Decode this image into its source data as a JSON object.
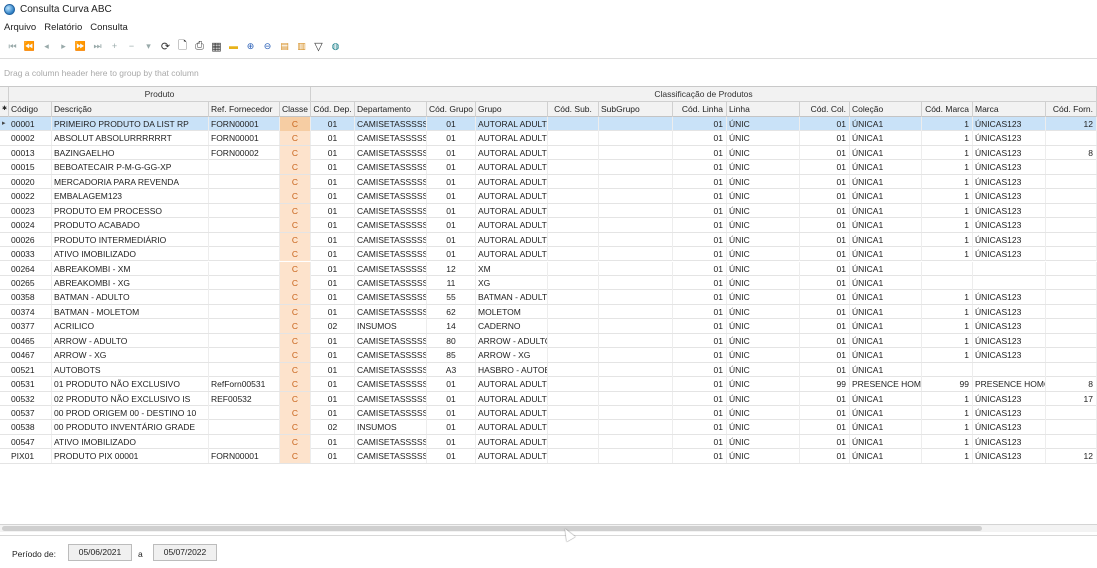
{
  "window": {
    "title": "Consulta Curva ABC"
  },
  "menu": [
    "Arquivo",
    "Relatório",
    "Consulta"
  ],
  "toolbar": {
    "nav": [
      "⏮",
      "⏪",
      "◂",
      "▸",
      "⏩",
      "⏭",
      "+",
      "−",
      "▾"
    ],
    "actions": [
      {
        "icon": "refresh-icon",
        "glyph": "⟳",
        "cls": "active"
      },
      {
        "icon": "preview-icon",
        "glyph": "🗋",
        "cls": "active"
      },
      {
        "icon": "print-icon",
        "glyph": "⎙",
        "cls": "active"
      },
      {
        "icon": "export-icon",
        "glyph": "▦",
        "cls": "active"
      },
      {
        "icon": "highlight-icon",
        "glyph": "▬",
        "cls": "yellow"
      },
      {
        "icon": "zoom-in-icon",
        "glyph": "⊕",
        "cls": "blue"
      },
      {
        "icon": "zoom-out-icon",
        "glyph": "⊖",
        "cls": "blue"
      },
      {
        "icon": "layout-icon",
        "glyph": "▤",
        "cls": "orange"
      },
      {
        "icon": "report-icon",
        "glyph": "▥",
        "cls": "orange"
      },
      {
        "icon": "filter-icon",
        "glyph": "▽",
        "cls": "active"
      },
      {
        "icon": "globe-icon",
        "glyph": "◍",
        "cls": "teal"
      }
    ]
  },
  "group_panel": {
    "text": "Drag a column header here to group by that column"
  },
  "bands": [
    {
      "label": "Produto",
      "key": "produto"
    },
    {
      "label": "Classificação de Produtos",
      "key": "classificacao"
    }
  ],
  "columns": [
    {
      "key": "codigo",
      "label": "Código",
      "align": "left"
    },
    {
      "key": "descricao",
      "label": "Descrição",
      "align": "left"
    },
    {
      "key": "ref",
      "label": "Ref. Fornecedor",
      "align": "left"
    },
    {
      "key": "classe",
      "label": "Classe",
      "align": "center"
    },
    {
      "key": "cod_dep",
      "label": "Cód. Dep.",
      "align": "center"
    },
    {
      "key": "departamento",
      "label": "Departamento",
      "align": "left"
    },
    {
      "key": "cod_grupo",
      "label": "Cód. Grupo",
      "align": "center"
    },
    {
      "key": "grupo",
      "label": "Grupo",
      "align": "left"
    },
    {
      "key": "cod_sub",
      "label": "Cód. Sub.",
      "align": "center"
    },
    {
      "key": "subgrupo",
      "label": "SubGrupo",
      "align": "left"
    },
    {
      "key": "cod_linha",
      "label": "Cód. Linha",
      "align": "num"
    },
    {
      "key": "linha",
      "label": "Linha",
      "align": "left"
    },
    {
      "key": "cod_col",
      "label": "Cód. Col.",
      "align": "num"
    },
    {
      "key": "colecao",
      "label": "Coleção",
      "align": "left"
    },
    {
      "key": "cod_marca",
      "label": "Cód. Marca",
      "align": "num"
    },
    {
      "key": "marca",
      "label": "Marca",
      "align": "left"
    },
    {
      "key": "cod_forn",
      "label": "Cód. Forn.",
      "align": "num"
    }
  ],
  "rows": [
    [
      "00001",
      "PRIMEIRO PRODUTO DA LIST RP",
      "FORN00001",
      "C",
      "01",
      "CAMISETASSSSSS",
      "01",
      "AUTORAL ADULTO",
      "",
      "",
      "01",
      "ÚNIC",
      "01",
      "ÚNICA1",
      "1",
      "ÚNICAS123",
      "12"
    ],
    [
      "00002",
      "ABSOLUT ABSOLURRRRRRT",
      "FORN00001",
      "C",
      "01",
      "CAMISETASSSSSS",
      "01",
      "AUTORAL ADULTO",
      "",
      "",
      "01",
      "ÚNIC",
      "01",
      "ÚNICA1",
      "1",
      "ÚNICAS123",
      ""
    ],
    [
      "00013",
      "BAZINGAELHO",
      "FORN00002",
      "C",
      "01",
      "CAMISETASSSSSS",
      "01",
      "AUTORAL ADULTO",
      "",
      "",
      "01",
      "ÚNIC",
      "01",
      "ÚNICA1",
      "1",
      "ÚNICAS123",
      "8"
    ],
    [
      "00015",
      "BEBOATECAIR P-M-G-GG-XP",
      "",
      "C",
      "01",
      "CAMISETASSSSSS",
      "01",
      "AUTORAL ADULTO",
      "",
      "",
      "01",
      "ÚNIC",
      "01",
      "ÚNICA1",
      "1",
      "ÚNICAS123",
      ""
    ],
    [
      "00020",
      "MERCADORIA PARA REVENDA",
      "",
      "C",
      "01",
      "CAMISETASSSSSS",
      "01",
      "AUTORAL ADULTO",
      "",
      "",
      "01",
      "ÚNIC",
      "01",
      "ÚNICA1",
      "1",
      "ÚNICAS123",
      ""
    ],
    [
      "00022",
      "EMBALAGEM123",
      "",
      "C",
      "01",
      "CAMISETASSSSSS",
      "01",
      "AUTORAL ADULTO",
      "",
      "",
      "01",
      "ÚNIC",
      "01",
      "ÚNICA1",
      "1",
      "ÚNICAS123",
      ""
    ],
    [
      "00023",
      "PRODUTO EM PROCESSO",
      "",
      "C",
      "01",
      "CAMISETASSSSSS",
      "01",
      "AUTORAL ADULTO",
      "",
      "",
      "01",
      "ÚNIC",
      "01",
      "ÚNICA1",
      "1",
      "ÚNICAS123",
      ""
    ],
    [
      "00024",
      "PRODUTO ACABADO",
      "",
      "C",
      "01",
      "CAMISETASSSSSS",
      "01",
      "AUTORAL ADULTO",
      "",
      "",
      "01",
      "ÚNIC",
      "01",
      "ÚNICA1",
      "1",
      "ÚNICAS123",
      ""
    ],
    [
      "00026",
      "PRODUTO INTERMEDIÁRIO",
      "",
      "C",
      "01",
      "CAMISETASSSSSS",
      "01",
      "AUTORAL ADULTO",
      "",
      "",
      "01",
      "ÚNIC",
      "01",
      "ÚNICA1",
      "1",
      "ÚNICAS123",
      ""
    ],
    [
      "00033",
      "ATIVO IMOBILIZADO",
      "",
      "C",
      "01",
      "CAMISETASSSSSS",
      "01",
      "AUTORAL ADULTO",
      "",
      "",
      "01",
      "ÚNIC",
      "01",
      "ÚNICA1",
      "1",
      "ÚNICAS123",
      ""
    ],
    [
      "00264",
      "ABREAKOMBI - XM",
      "",
      "C",
      "01",
      "CAMISETASSSSSS",
      "12",
      "XM",
      "",
      "",
      "01",
      "ÚNIC",
      "01",
      "ÚNICA1",
      "",
      "",
      ""
    ],
    [
      "00265",
      "ABREAKOMBI - XG",
      "",
      "C",
      "01",
      "CAMISETASSSSSS",
      "11",
      "XG",
      "",
      "",
      "01",
      "ÚNIC",
      "01",
      "ÚNICA1",
      "",
      "",
      ""
    ],
    [
      "00358",
      "BATMAN - ADULTO",
      "",
      "C",
      "01",
      "CAMISETASSSSSS",
      "55",
      "BATMAN - ADULTO",
      "",
      "",
      "01",
      "ÚNIC",
      "01",
      "ÚNICA1",
      "1",
      "ÚNICAS123",
      ""
    ],
    [
      "00374",
      "BATMAN - MOLETOM",
      "",
      "C",
      "01",
      "CAMISETASSSSSS",
      "62",
      "MOLETOM",
      "",
      "",
      "01",
      "ÚNIC",
      "01",
      "ÚNICA1",
      "1",
      "ÚNICAS123",
      ""
    ],
    [
      "00377",
      "ACRILICO",
      "",
      "C",
      "02",
      "INSUMOS",
      "14",
      "CADERNO",
      "",
      "",
      "01",
      "ÚNIC",
      "01",
      "ÚNICA1",
      "1",
      "ÚNICAS123",
      ""
    ],
    [
      "00465",
      "ARROW - ADULTO",
      "",
      "C",
      "01",
      "CAMISETASSSSSS",
      "80",
      "ARROW - ADULTO",
      "",
      "",
      "01",
      "ÚNIC",
      "01",
      "ÚNICA1",
      "1",
      "ÚNICAS123",
      ""
    ],
    [
      "00467",
      "ARROW - XG",
      "",
      "C",
      "01",
      "CAMISETASSSSSS",
      "85",
      "ARROW - XG",
      "",
      "",
      "01",
      "ÚNIC",
      "01",
      "ÚNICA1",
      "1",
      "ÚNICAS123",
      ""
    ],
    [
      "00521",
      "AUTOBOTS",
      "",
      "C",
      "01",
      "CAMISETASSSSSS",
      "A3",
      "HASBRO - AUTOBOTS",
      "",
      "",
      "01",
      "ÚNIC",
      "01",
      "ÚNICA1",
      "",
      "",
      ""
    ],
    [
      "00531",
      "01 PRODUTO NÃO EXCLUSIVO",
      "RefForn00531",
      "C",
      "01",
      "CAMISETASSSSSS",
      "01",
      "AUTORAL ADULTO",
      "",
      "",
      "01",
      "ÚNIC",
      "99",
      "PRESENCE HOMO",
      "99",
      "PRESENCE HOMO",
      "8"
    ],
    [
      "00532",
      "02 PRODUTO NÃO EXCLUSIVO IS",
      "REF00532",
      "C",
      "01",
      "CAMISETASSSSSS",
      "01",
      "AUTORAL ADULTO",
      "",
      "",
      "01",
      "ÚNIC",
      "01",
      "ÚNICA1",
      "1",
      "ÚNICAS123",
      "17"
    ],
    [
      "00537",
      "00 PROD ORIGEM 00 - DESTINO 10",
      "",
      "C",
      "01",
      "CAMISETASSSSSS",
      "01",
      "AUTORAL ADULTO",
      "",
      "",
      "01",
      "ÚNIC",
      "01",
      "ÚNICA1",
      "1",
      "ÚNICAS123",
      ""
    ],
    [
      "00538",
      "00 PRODUTO INVENTÁRIO GRADE",
      "",
      "C",
      "02",
      "INSUMOS",
      "01",
      "AUTORAL ADULTO",
      "",
      "",
      "01",
      "ÚNIC",
      "01",
      "ÚNICA1",
      "1",
      "ÚNICAS123",
      ""
    ],
    [
      "00547",
      "ATIVO IMOBILIZADO",
      "",
      "C",
      "01",
      "CAMISETASSSSSS",
      "01",
      "AUTORAL ADULTO",
      "",
      "",
      "01",
      "ÚNIC",
      "01",
      "ÚNICA1",
      "1",
      "ÚNICAS123",
      ""
    ],
    [
      "PIX01",
      "PRODUTO PIX 00001",
      "FORN00001",
      "C",
      "01",
      "CAMISETASSSSSS",
      "01",
      "AUTORAL ADULTO",
      "",
      "",
      "01",
      "ÚNIC",
      "01",
      "ÚNICA1",
      "1",
      "ÚNICAS123",
      "12"
    ]
  ],
  "selected_row": 0,
  "footer": {
    "period_label": "Período de:",
    "date_from": "05/06/2021",
    "separator": "a",
    "date_to": "05/07/2022"
  },
  "colors": {
    "selection": "#c9e2f8",
    "classe_bg": "#fde3cc",
    "classe_text": "#c8641b"
  }
}
